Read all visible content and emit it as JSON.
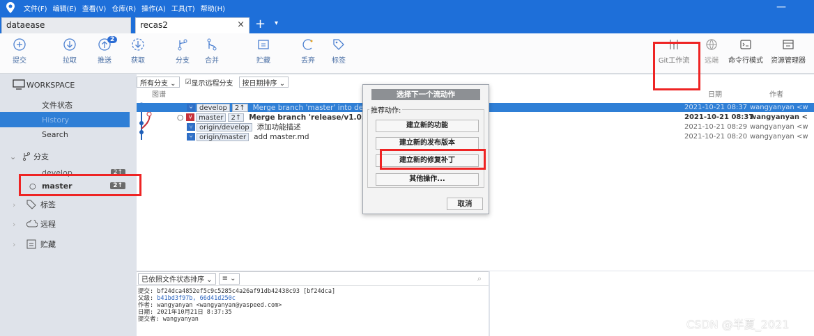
{
  "menu": [
    "文件(F)",
    "编辑(E)",
    "查看(V)",
    "仓库(R)",
    "操作(A)",
    "工具(T)",
    "帮助(H)"
  ],
  "window": {
    "minimize": "—"
  },
  "tabs": [
    {
      "label": "dataease"
    },
    {
      "label": "recas2",
      "close": "×"
    }
  ],
  "tabbar": {
    "plus": "+",
    "caret": "▾"
  },
  "toolbar": {
    "left": [
      {
        "label": "提交",
        "icon": "plus-circle-icon"
      },
      {
        "label": "拉取",
        "icon": "arrow-down-circle-icon"
      },
      {
        "label": "推送",
        "icon": "arrow-up-circle-icon",
        "badge": "2"
      },
      {
        "label": "获取",
        "icon": "fetch-icon"
      },
      {
        "label": "分支",
        "icon": "branch-icon"
      },
      {
        "label": "合并",
        "icon": "merge-icon"
      },
      {
        "label": "贮藏",
        "icon": "stash-icon"
      },
      {
        "label": "丢弃",
        "icon": "discard-icon"
      },
      {
        "label": "标签",
        "icon": "tag-icon"
      }
    ],
    "right": [
      {
        "label": "Git工作流",
        "icon": "git-flow-icon"
      },
      {
        "label": "远端",
        "icon": "globe-icon"
      },
      {
        "label": "命令行模式",
        "icon": "terminal-icon"
      },
      {
        "label": "资源管理器",
        "icon": "explorer-icon"
      }
    ]
  },
  "sidebar": {
    "workspace": "WORKSPACE",
    "file_status": "文件状态",
    "history": "History",
    "search": "Search",
    "branches_header": "分支",
    "branches": [
      {
        "name": "develop",
        "count": "2↑"
      },
      {
        "name": "master",
        "count": "2↑"
      }
    ],
    "tags": "标签",
    "remotes": "远程",
    "stashes": "贮藏"
  },
  "filters": {
    "all_branches": "所有分支 ⌄",
    "show_remote_checkbox": "☑",
    "show_remote": "显示远程分支",
    "sort_by_date": "按日期排序 ⌄"
  },
  "columns": {
    "graph": "图谱",
    "date": "日期",
    "author": "作者"
  },
  "commits": [
    {
      "tags": [
        {
          "label": "develop"
        },
        {
          "label": "2↑"
        }
      ],
      "message": "Merge branch 'master' into develop",
      "date": "2021-10-21 08:37",
      "author": "wangyanyan <w",
      "selected": true
    },
    {
      "head": "○",
      "tags": [
        {
          "label": "master"
        },
        {
          "label": "2↑"
        }
      ],
      "message": "Merge branch 'release/v1.0.0'",
      "date": "2021-10-21 08:37",
      "author": "wangyanyan <",
      "bold": true
    },
    {
      "tags": [
        {
          "label": "origin/develop"
        }
      ],
      "message": "添加功能描述",
      "date": "2021-10-21 08:29",
      "author": "wangyanyan <w"
    },
    {
      "tags": [
        {
          "label": "origin/master"
        }
      ],
      "message": "add master.md",
      "date": "2021-10-21 08:20",
      "author": "wangyanyan <w"
    }
  ],
  "detail": {
    "sort_label": "已依照文件状态排序 ⌄",
    "view_label": "≡ ⌄",
    "commit_label": "提交:",
    "commit_value": "bf24dca4852ef5c9c5285c4a26af91db42438c93 [bf24dca]",
    "parents_label": "父级:",
    "parents_value": "b41bd3f97b, 66d41d250c",
    "author_label": "作者:",
    "author_value": "wangyanyan <wangyanyan@yaspeed.com>",
    "date_label": "日期:",
    "date_value": "2021年10月21日 8:37:35",
    "committer_label": "提交者:",
    "committer_value": "wangyanyan"
  },
  "dialog": {
    "title": "选择下一个流动作",
    "group": "推荐动作:",
    "buttons": [
      "建立新的功能",
      "建立新的发布版本",
      "建立新的修复补丁",
      "其他操作..."
    ],
    "cancel": "取消"
  },
  "watermark": "CSDN @半夏_2021",
  "colors": {
    "accent": "#1e6fd9",
    "selection": "#2f7fd6",
    "highlight": "#ee2424"
  }
}
